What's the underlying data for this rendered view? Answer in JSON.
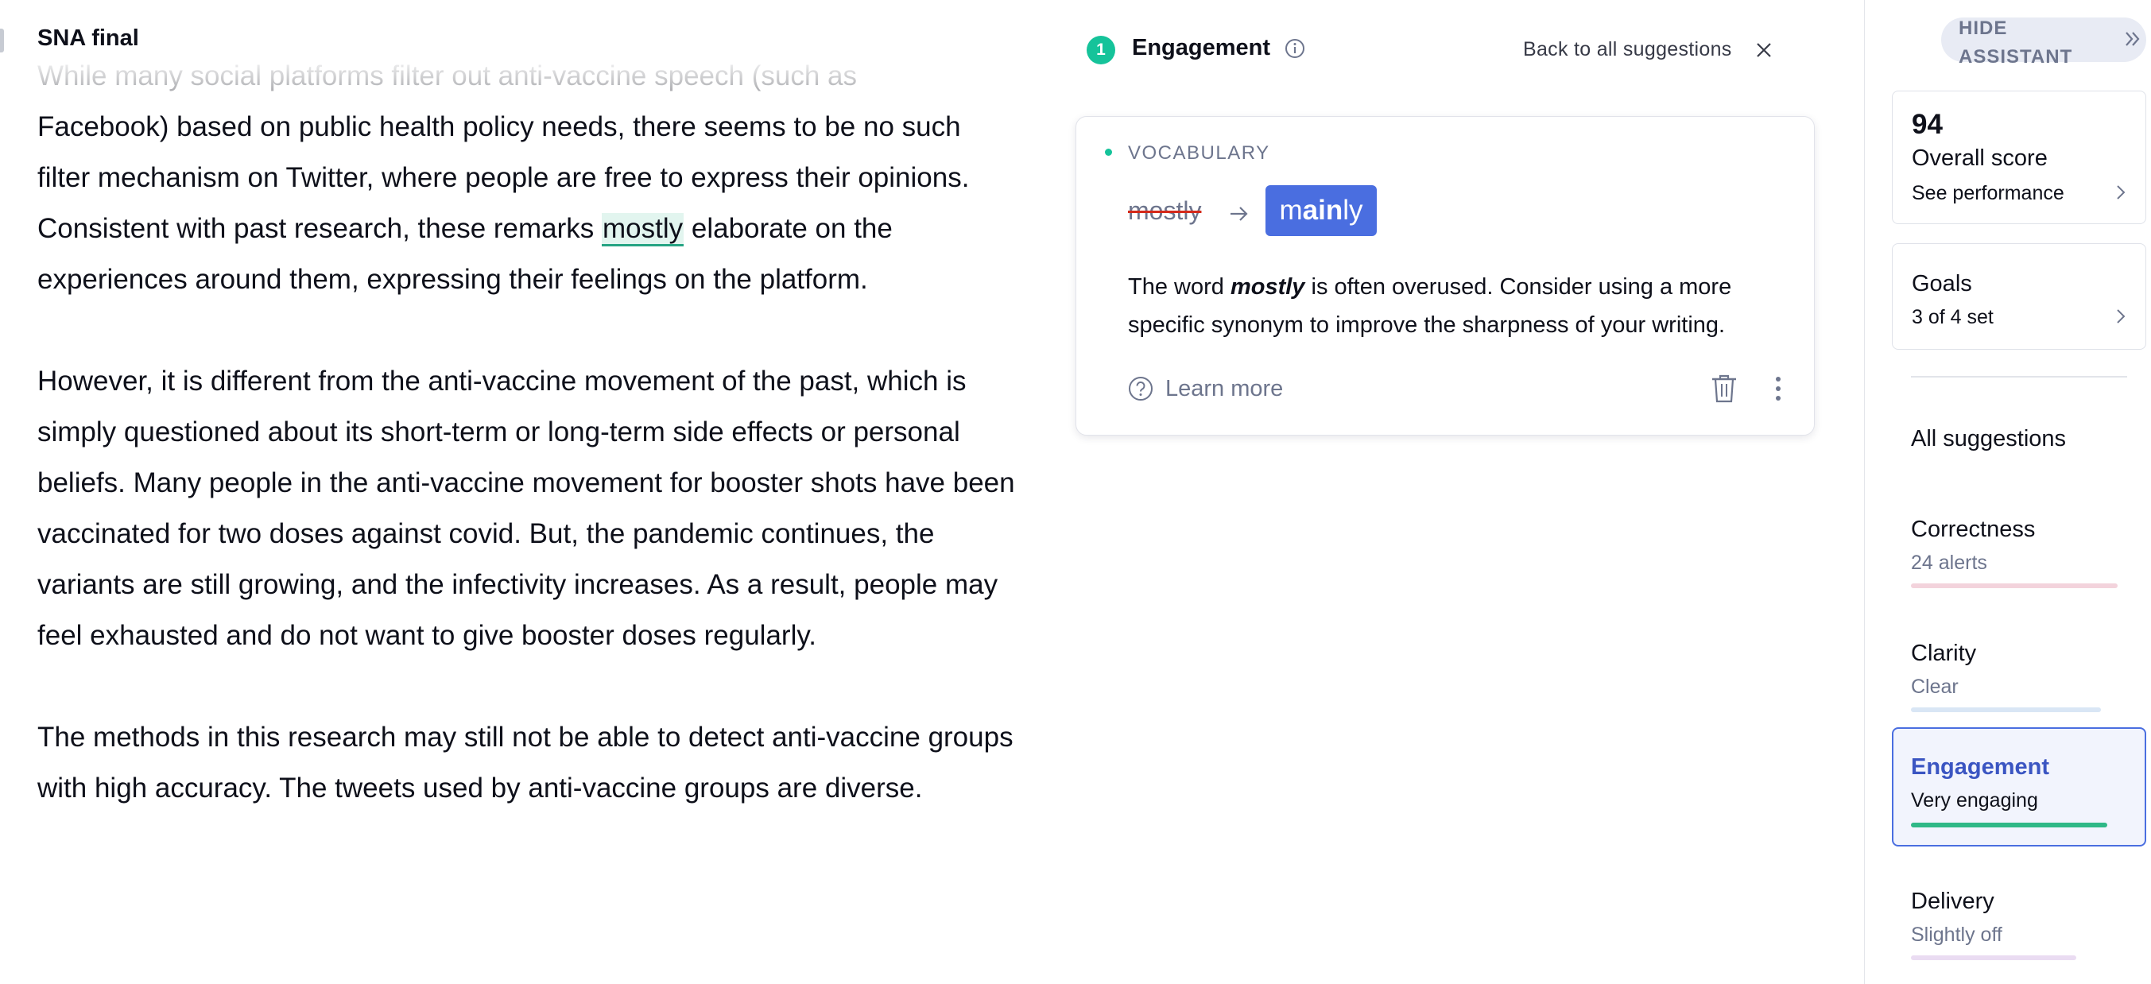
{
  "document": {
    "title": "SNA final",
    "faded_line": "While many social platforms filter out anti-vaccine speech (such as",
    "para1_before": "Facebook) based on public health policy needs, there seems to be no such filter mechanism on Twitter, where people are free to express their opinions. Consistent with past research, these remarks ",
    "para1_highlight": "mostly",
    "para1_after": " elaborate on the experiences around them, expressing their feelings on the platform.",
    "para2": "However, it is different from the anti-vaccine movement of the past, which is simply questioned about its short-term or long-term side effects or personal beliefs. Many people in the anti-vaccine movement for booster shots have been vaccinated for two doses against covid. But, the pandemic continues, the variants are still growing, and the infectivity increases. As a result, people may feel exhausted and do not want to give booster doses regularly.",
    "para3": "The methods in this research may still not be able to detect anti-vaccine groups with high accuracy. The tweets used by anti-vaccine groups are diverse."
  },
  "panel": {
    "count": "1",
    "title": "Engagement",
    "back_label": "Back to all suggestions",
    "icons": {
      "info": "info-icon",
      "close": "close-icon"
    }
  },
  "suggestion": {
    "category": "VOCABULARY",
    "original": "mostly",
    "replacement_parts": [
      "m",
      "ain",
      "ly"
    ],
    "desc_before": "The word ",
    "desc_word": "mostly",
    "desc_after": " is often overused. Consider using a more specific synonym to improve the sharpness of your writing.",
    "learn_more": "Learn more",
    "colors": {
      "accent": "#4a6ee0",
      "dot": "#15c39a",
      "strike": "#d4291a"
    }
  },
  "sidebar": {
    "hide_label": "HIDE ASSISTANT",
    "score": {
      "value": "94",
      "label": "Overall score",
      "link": "See performance"
    },
    "goals": {
      "label": "Goals",
      "sub": "3 of 4 set"
    },
    "all_suggestions": "All suggestions",
    "categories": [
      {
        "name": "Correctness",
        "status": "24 alerts",
        "color": "#f3d3dc",
        "fill": 1.0
      },
      {
        "name": "Clarity",
        "status": "Clear",
        "color": "#d9e6f5",
        "fill": 0.92
      },
      {
        "name": "Engagement",
        "status": "Very engaging",
        "color": "#2fb887",
        "fill": 0.95
      },
      {
        "name": "Delivery",
        "status": "Slightly off",
        "color": "#eadcf2",
        "fill": 0.8
      }
    ]
  }
}
